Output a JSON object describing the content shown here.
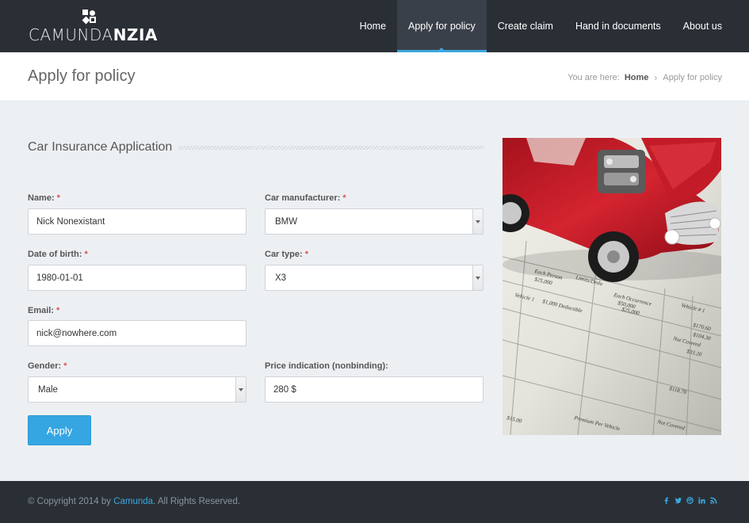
{
  "header": {
    "logo_light": "CAMUNDA",
    "logo_bold": "NZIA",
    "nav": [
      {
        "label": "Home"
      },
      {
        "label": "Apply for policy"
      },
      {
        "label": "Create claim"
      },
      {
        "label": "Hand in documents"
      },
      {
        "label": "About us"
      }
    ]
  },
  "titlebar": {
    "title": "Apply for policy",
    "breadcrumb_prefix": "You are here:",
    "breadcrumb_home": "Home",
    "breadcrumb_sep": "›",
    "breadcrumb_current": "Apply for policy"
  },
  "form": {
    "section_title": "Car Insurance Application",
    "required_mark": "*",
    "name": {
      "label": "Name:",
      "value": "Nick Nonexistant"
    },
    "birth": {
      "label": "Date of birth:",
      "value": "1980-01-01"
    },
    "email": {
      "label": "Email:",
      "value": "nick@nowhere.com"
    },
    "gender": {
      "label": "Gender:",
      "value": "Male"
    },
    "manufacturer": {
      "label": "Car manufacturer:",
      "value": "BMW"
    },
    "cartype": {
      "label": "Car type:",
      "value": "X3"
    },
    "price": {
      "label": "Price indication (nonbinding):",
      "value": "280 $"
    },
    "apply_label": "Apply"
  },
  "photo": {
    "doc_lines": [
      "Each Person",
      "Limits/Dedu",
      "$25,000",
      "Each Occurrence",
      "Vehicle 1",
      "$1,000 Deductible",
      "$50,000",
      "$25,000",
      "Vehicle # 1",
      "$170.60",
      "$104.30",
      "Not Covered",
      "$33.20",
      "$118.70",
      "$15.00",
      "Premium Per Vehicle",
      "Not Covered"
    ]
  },
  "footer": {
    "copyright_pre": "© Copyright 2014 by",
    "copyright_link": "Camunda",
    "copyright_post": ". All Rights Reserved.",
    "social_icons": [
      "facebook-icon",
      "twitter-icon",
      "dribbble-icon",
      "linkedin-icon",
      "rss-icon"
    ]
  },
  "colors": {
    "header_bg": "#2a2f36",
    "accent": "#35a6e2",
    "required": "#d9534f",
    "page_bg": "#edf0f3"
  }
}
